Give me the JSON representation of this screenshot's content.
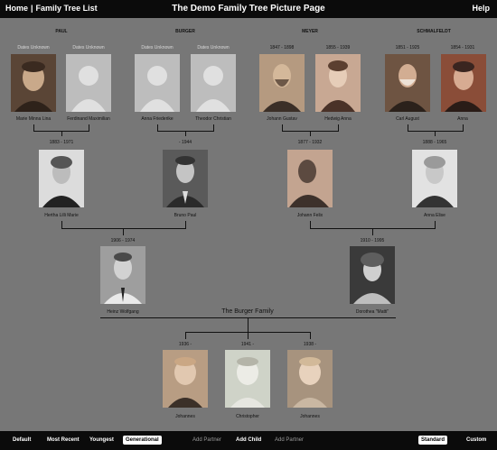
{
  "header": {
    "home": "Home",
    "separator": "|",
    "tree_list": "Family Tree List",
    "title": "The Demo Family Tree Picture Page",
    "help": "Help"
  },
  "surnames": [
    "PAUL",
    "BURGER",
    "MEYER",
    "SCHMALFELDT"
  ],
  "grandparents": [
    {
      "name": "Marie Minna Lina",
      "dates": "Dates Unknown",
      "photo_icon": "sepia-portrait-elderly-woman"
    },
    {
      "name": "Ferdinand Maximilian",
      "dates": "Dates Unknown",
      "photo_icon": "silhouette-placeholder"
    },
    {
      "name": "Anna Friederike",
      "dates": "Dates Unknown",
      "photo_icon": "silhouette-placeholder"
    },
    {
      "name": "Theodor Christian",
      "dates": "Dates Unknown",
      "photo_icon": "silhouette-placeholder"
    },
    {
      "name": "Johann Gustav",
      "dates": "1847 - 1898",
      "photo_icon": "sepia-portrait-bearded-man"
    },
    {
      "name": "Hedwig Anna",
      "dates": "1855 - 1939",
      "photo_icon": "sepia-portrait-woman"
    },
    {
      "name": "Carl August",
      "dates": "1851 - 1925",
      "photo_icon": "sepia-portrait-man-beard"
    },
    {
      "name": "Anna",
      "dates": "1854 - 1931",
      "photo_icon": "sepia-portrait-elderly-woman"
    }
  ],
  "parents": [
    {
      "name": "Hertha Lilli Marie",
      "dates": "1883 - 1971",
      "photo_icon": "bw-portrait-woman"
    },
    {
      "name": "Bruno Paul",
      "dates": "- 1944",
      "photo_icon": "bw-portrait-man"
    },
    {
      "name": "Johann Felix",
      "dates": "1877 - 1932",
      "photo_icon": "sepia-profile-man"
    },
    {
      "name": "Anna Elise",
      "dates": "1888 - 1965",
      "photo_icon": "bw-portrait-elderly-woman"
    }
  ],
  "couple": [
    {
      "name": "Heinz Wolfgang",
      "dates": "1906 - 1974",
      "photo_icon": "bw-portrait-young-man"
    },
    {
      "name": "Dorothea \"Matti\"",
      "dates": "1910 - 1995",
      "photo_icon": "bw-portrait-woman-curls"
    }
  ],
  "family_name": "The Burger Family",
  "children": [
    {
      "name": "Johannes",
      "dates": "1936 -",
      "photo_icon": "sepia-child-photo"
    },
    {
      "name": "Christopher",
      "dates": "1941 -",
      "photo_icon": "bw-child-photo"
    },
    {
      "name": "Johannes",
      "dates": "1938 -",
      "photo_icon": "sepia-child-photo"
    }
  ],
  "footer": {
    "default": "Default",
    "most_recent": "Most Recent",
    "youngest": "Youngest",
    "generational": "Generational",
    "add_partner_1": "Add Partner",
    "add_child": "Add Child",
    "add_partner_2": "Add Partner",
    "standard": "Standard",
    "custom": "Custom"
  },
  "colors": {
    "bar": "#0b0b0b",
    "background": "#777777",
    "line": "#111111"
  }
}
